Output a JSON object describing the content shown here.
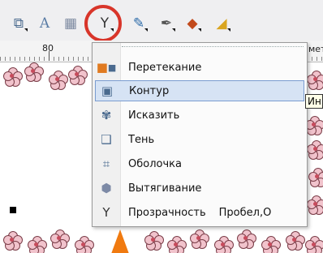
{
  "toolbar": {
    "icons": [
      "effects-icon",
      "text-icon",
      "table-icon",
      "transparency-icon",
      "eyedropper-icon",
      "outline-pen-icon",
      "fill-icon",
      "interactive-fill-icon"
    ]
  },
  "ruler": {
    "label": "80",
    "right_label": "мет"
  },
  "menu": {
    "items": [
      {
        "label": "Перетекание",
        "icon": "blend-icon",
        "shortcut": ""
      },
      {
        "label": "Контур",
        "icon": "contour-icon",
        "shortcut": ""
      },
      {
        "label": "Исказить",
        "icon": "distort-icon",
        "shortcut": ""
      },
      {
        "label": "Тень",
        "icon": "shadow-icon",
        "shortcut": ""
      },
      {
        "label": "Оболочка",
        "icon": "envelope-icon",
        "shortcut": ""
      },
      {
        "label": "Вытягивание",
        "icon": "extrude-icon",
        "shortcut": ""
      },
      {
        "label": "Прозрачность",
        "icon": "transparency-icon",
        "shortcut": "Пробел,О"
      }
    ],
    "selected_index": 1
  },
  "tooltip": {
    "text": "Ин"
  },
  "colors": {
    "highlight_ring": "#d8352a",
    "selection_bg": "#d6e3f4",
    "petal": "#f1c3cc",
    "orange_shape": "#f07a10"
  }
}
